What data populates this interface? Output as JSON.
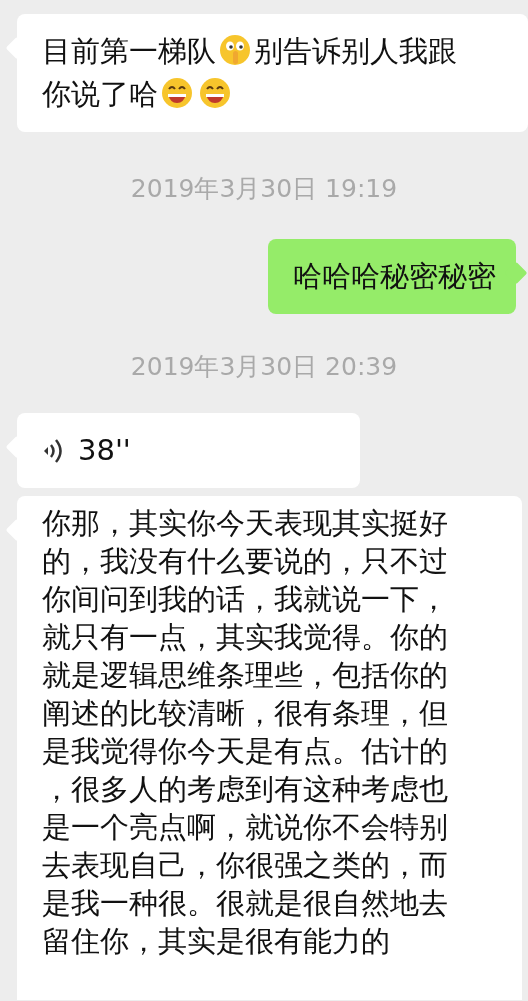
{
  "messages": [
    {
      "kind": "text",
      "outgoing": false,
      "segments": [
        {
          "kind": "text",
          "text": "目前第一梯队"
        },
        {
          "kind": "shush"
        },
        {
          "kind": "text",
          "text": "别告诉别人我跟"
        },
        {
          "kind": "break"
        },
        {
          "kind": "text",
          "text": "你说了哈"
        },
        {
          "kind": "grin"
        },
        {
          "kind": "grin"
        }
      ]
    },
    {
      "kind": "time",
      "text": "2019年3月30日 19:19"
    },
    {
      "kind": "text",
      "outgoing": true,
      "segments": [
        {
          "kind": "text",
          "text": "哈哈哈秘密秘密"
        }
      ]
    },
    {
      "kind": "time",
      "text": "2019年3月30日 20:39"
    },
    {
      "kind": "voice",
      "outgoing": false,
      "duration": "38''"
    },
    {
      "kind": "longtext",
      "outgoing": false,
      "lines": [
        "你那，其实你今天表现其实挺好",
        "的，我没有什么要说的，只不过",
        "你间问到我的话，我就说一下，",
        "就只有一点，其实我觉得。你的",
        "就是逻辑思维条理些，包括你的",
        "阐述的比较清晰，很有条理，但",
        "是我觉得你今天是有点。估计的",
        "，很多人的考虑到有这种考虑也",
        "是一个亮点啊，就说你不会特别",
        "去表现自己，你很强之类的，而",
        "是我一种很。很就是很自然地去",
        "留住你，其实是很有能力的"
      ]
    }
  ]
}
